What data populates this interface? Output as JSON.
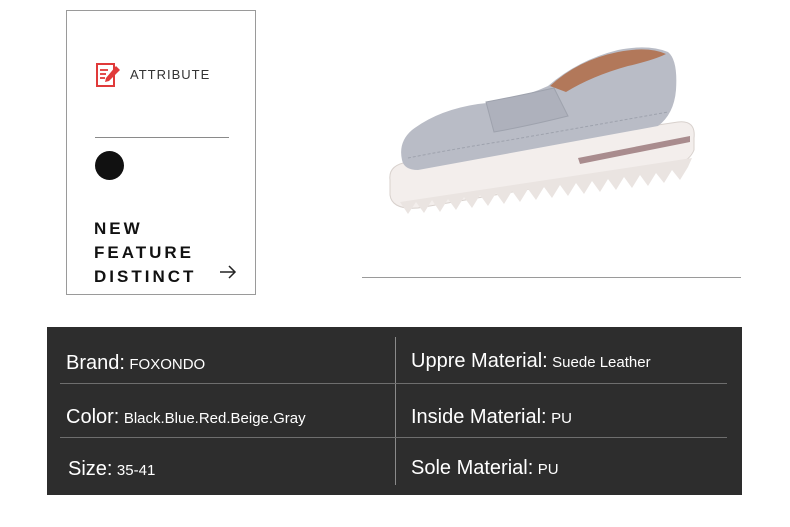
{
  "card": {
    "attribute_label": "ATTRIBUTE",
    "feature_lines": [
      "NEW",
      "FEATURE",
      "DISTINCT"
    ],
    "icons": [
      "document-edit-icon",
      "dot-icon",
      "arrow-right-icon"
    ],
    "accent_color": "#e03a3a",
    "dot_color": "#111111"
  },
  "product_image": {
    "subject": "gray suede platform loafer",
    "upper_color": "#b9bcc6",
    "sole_color": "#f3eeec"
  },
  "specs": {
    "background": "#2d2d2d",
    "rows": [
      {
        "left_key": "Brand:",
        "left_value": "FOXONDO",
        "right_key": "Uppre Material:",
        "right_value": "Suede Leather"
      },
      {
        "left_key": "Color:",
        "left_value": "Black.Blue.Red.Beige.Gray",
        "right_key": "Inside Material:",
        "right_value": "PU"
      },
      {
        "left_key": "Size:",
        "left_value": "35-41",
        "right_key": "Sole Material:",
        "right_value": "PU"
      }
    ]
  }
}
